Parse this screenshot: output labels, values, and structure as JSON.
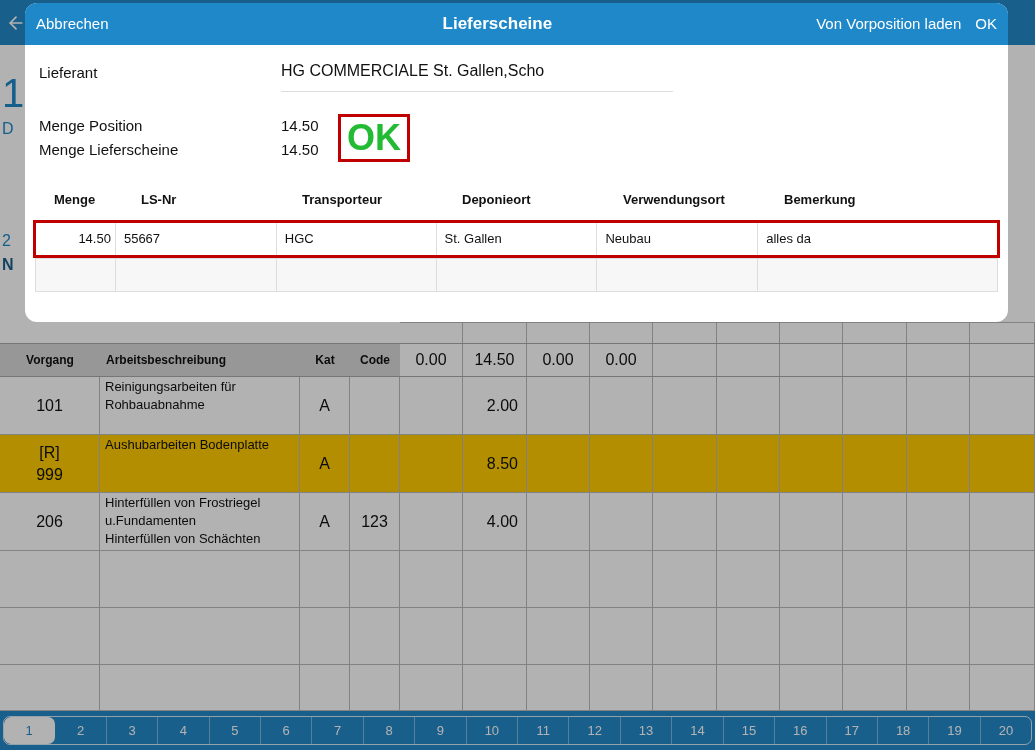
{
  "background": {
    "fragments": [
      {
        "text": "1",
        "kind": "number"
      },
      {
        "text": "D",
        "kind": "caption"
      },
      {
        "text": "2",
        "kind": "caption"
      },
      {
        "text": "N",
        "kind": "strong"
      }
    ],
    "table": {
      "columns": [
        "Vorgang",
        "Arbeitsbeschreibung",
        "Kat",
        "Code"
      ],
      "totals": [
        "0.00",
        "14.50",
        "0.00",
        "0.00"
      ],
      "rows": [
        {
          "vorgang": "101",
          "description": "Reinigungsarbeiten für Rohbauabnahme",
          "kat": "A",
          "amount": "2.00",
          "selected": false
        },
        {
          "prefix": "[R]",
          "vorgang": "999",
          "description": "Aushubarbeiten Bodenplatte",
          "kat": "A",
          "amount": "8.50",
          "selected": true
        },
        {
          "vorgang": "206",
          "description": "Hinterfüllen von Frostriegel u.Fundamenten\nHinterfüllen von Schächten",
          "kat": "A",
          "code": "123",
          "amount": "4.00",
          "selected": false
        }
      ]
    },
    "pages": [
      {
        "label": "1",
        "selected": true
      },
      {
        "label": "2",
        "selected": false
      },
      {
        "label": "3",
        "selected": false
      },
      {
        "label": "4",
        "selected": false
      },
      {
        "label": "5",
        "selected": false
      },
      {
        "label": "6",
        "selected": false
      },
      {
        "label": "7",
        "selected": false
      },
      {
        "label": "8",
        "selected": false
      },
      {
        "label": "9",
        "selected": false
      },
      {
        "label": "10",
        "selected": false
      },
      {
        "label": "11",
        "selected": false
      },
      {
        "label": "12",
        "selected": false
      },
      {
        "label": "13",
        "selected": false
      },
      {
        "label": "14",
        "selected": false
      },
      {
        "label": "15",
        "selected": false
      },
      {
        "label": "16",
        "selected": false
      },
      {
        "label": "17",
        "selected": false
      },
      {
        "label": "18",
        "selected": false
      },
      {
        "label": "19",
        "selected": false
      },
      {
        "label": "20",
        "selected": false
      }
    ]
  },
  "dialog": {
    "title": "Lieferscheine",
    "cancel": "Abbrechen",
    "load_button": "Von Vorposition laden",
    "ok_button": "OK",
    "supplier": {
      "label": "Lieferant",
      "value": "HG COMMERCIALE St. Gallen,Scho"
    },
    "quantities": [
      {
        "label": "Menge Position",
        "value": "14.50"
      },
      {
        "label": "Menge Lieferscheine",
        "value": "14.50"
      }
    ],
    "status": "OK",
    "columns": [
      "Menge",
      "LS-Nr",
      "Transporteur",
      "Deponieort",
      "Verwendungsort",
      "Bemerkung"
    ],
    "rows": [
      {
        "cells": [
          "14.50",
          "55667",
          "HGC",
          "St. Gallen",
          "Neubau",
          "alles da"
        ],
        "selected": true
      },
      {
        "selected": false
      }
    ]
  }
}
